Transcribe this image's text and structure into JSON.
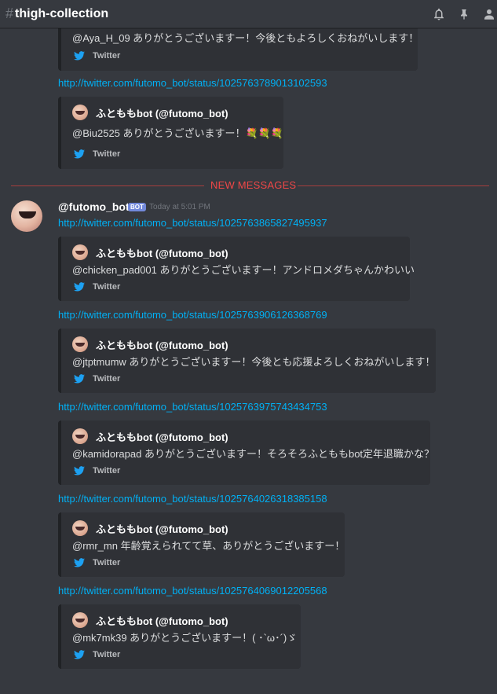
{
  "header": {
    "hash": "#",
    "channel_name": "thigh-collection",
    "icons": [
      "bell-icon",
      "pin-icon",
      "members-icon"
    ]
  },
  "colors": {
    "background": "#36393f",
    "embed_bg": "#2f3136",
    "link": "#00b0f4",
    "new_messages": "#f04747",
    "bot_tag": "#7289da",
    "twitter_blue": "#1da1f2"
  },
  "divider": {
    "label": "NEW MESSAGES"
  },
  "message": {
    "username": "@futomo_bot",
    "bot_tag": "BOT",
    "timestamp": "Today at 5:01 PM"
  },
  "top_embed_partial": {
    "description": "@Aya_H_09 ありがとうございますー！今後ともよろしくおねがいします！",
    "footer": "Twitter"
  },
  "items": [
    {
      "link": "http://twitter.com/futomo_bot/status/1025763789013102593",
      "embed": {
        "author": "ふとももbot (@futomo_bot)",
        "description": "@Biu2525 ありがとうございますー！💐💐💐",
        "footer": "Twitter"
      }
    },
    {
      "link": "http://twitter.com/futomo_bot/status/1025763865827495937",
      "embed": {
        "author": "ふとももbot (@futomo_bot)",
        "description": "@chicken_pad001 ありがとうございますー！アンドロメダちゃんかわいい",
        "footer": "Twitter"
      }
    },
    {
      "link": "http://twitter.com/futomo_bot/status/1025763906126368769",
      "embed": {
        "author": "ふとももbot (@futomo_bot)",
        "description": "@jtptmumw ありがとうございますー！今後とも応援よろしくおねがいします！",
        "footer": "Twitter"
      }
    },
    {
      "link": "http://twitter.com/futomo_bot/status/1025763975743434753",
      "embed": {
        "author": "ふとももbot (@futomo_bot)",
        "description": "@kamidorapad ありがとうございますー！そろそろふとももbot定年退職かな？",
        "footer": "Twitter"
      }
    },
    {
      "link": "http://twitter.com/futomo_bot/status/1025764026318385158",
      "embed": {
        "author": "ふとももbot (@futomo_bot)",
        "description": "@rmr_mn 年齢覚えられてて草、ありがとうございますー！",
        "footer": "Twitter"
      }
    },
    {
      "link": "http://twitter.com/futomo_bot/status/1025764069012205568",
      "embed": {
        "author": "ふとももbot (@futomo_bot)",
        "description": "@mk7mk39 ありがとうございますー！( ･`ω･´)ゞ",
        "footer": "Twitter"
      }
    }
  ]
}
